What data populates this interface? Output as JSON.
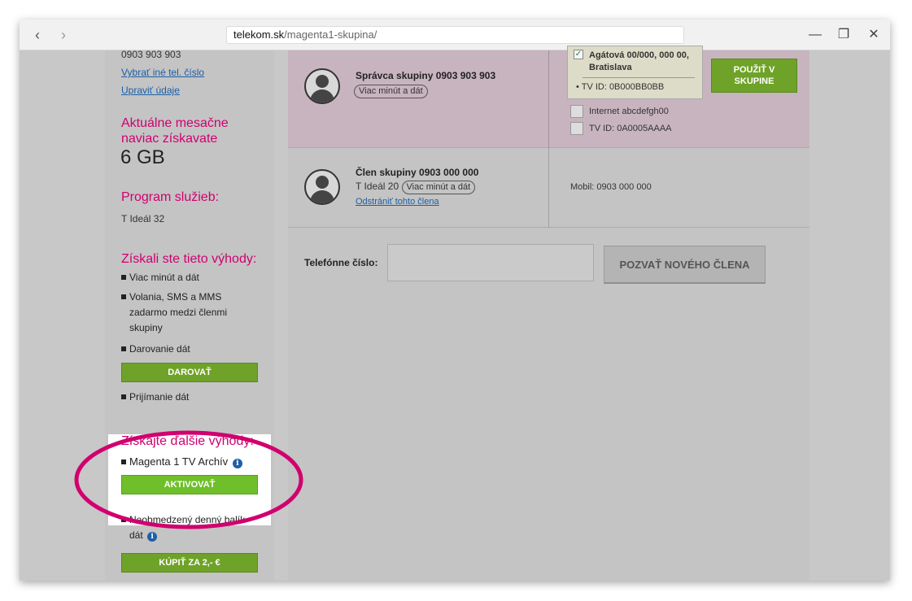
{
  "browser": {
    "url_host": "telekom.sk",
    "url_path": "/magenta1-skupina/",
    "back_icon": "‹",
    "forward_icon": "›",
    "minimize_icon": "—",
    "restore_icon": "❐",
    "close_icon": "✕"
  },
  "sidebar": {
    "phone": "0903 903 903",
    "choose_other_number": "Vybrať iné tel. číslo",
    "edit_details": "Upraviť údaje",
    "monthly_extra_heading_1": "Aktuálne mesačne",
    "monthly_extra_heading_2": "naviac získavate",
    "monthly_extra_value": "6 GB",
    "program_heading": "Program služieb:",
    "program_value": "T Ideál 32",
    "benefits_heading": "Získali ste tieto výhody:",
    "benefits": {
      "b1": "Viac minút a dát",
      "b2_l1": "Volania, SMS a MMS",
      "b2_l2": "zadarmo medzi členmi",
      "b2_l3": "skupiny",
      "b3": "Darovanie dát",
      "b4": "Prijímanie dát"
    },
    "donate_button": "DAROVAŤ",
    "more_heading": "Získajte ďalšie výhody:",
    "more_item": "Magenta 1 TV Archív",
    "activate_button": "AKTIVOVAŤ",
    "unlimited_l1": "Neobmedzený denný balík",
    "unlimited_l2": "dát",
    "buy_button": "KÚPIŤ ZA 2,- €"
  },
  "group": {
    "admin_title": "Správca skupiny 0903 903 903",
    "admin_pill": "Viac minút a dát",
    "address_l1": "Agátová 00/000, 000 00,",
    "address_l2": "Bratislava",
    "tv_id_selected": "TV ID: 0B000BB0BB",
    "use_in_group_l1": "POUŽIŤ V",
    "use_in_group_l2": "SKUPINE",
    "internet_item": "Internet abcdefgh00",
    "tv_id_2": "TV ID: 0A0005AAAA",
    "member_title": "Člen skupiny 0903 000 000",
    "member_program": "T Ideál 20",
    "member_pill": "Viac minút a dát",
    "remove_member": "Odstrániť tohto člena",
    "member_mobile": "Mobil: 0903 000 000"
  },
  "invite": {
    "phone_label": "Telefónne číslo:",
    "phone_value": "",
    "invite_button": "POZVAŤ NOVÉHO ČLENA"
  },
  "colors": {
    "magenta": "#d0006f",
    "green": "#6fa228",
    "highlight_ring": "#d0006f"
  }
}
